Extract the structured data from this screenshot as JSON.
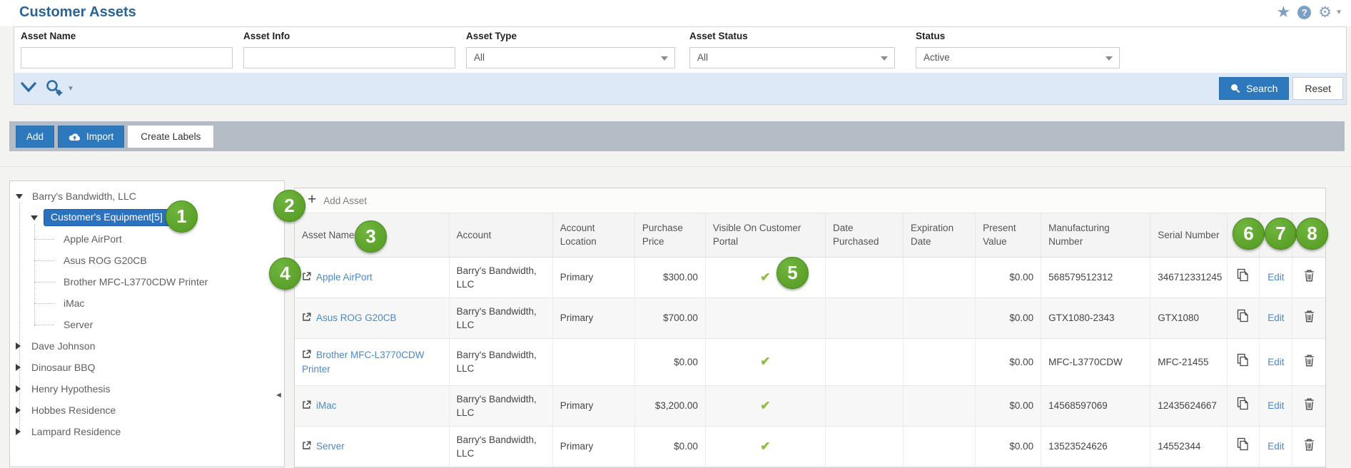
{
  "page": {
    "title": "Customer Assets"
  },
  "header_icons": {
    "help_text": "?"
  },
  "filters": {
    "fields": [
      {
        "label": "Asset Name",
        "type": "text",
        "value": ""
      },
      {
        "label": "Asset Info",
        "type": "text",
        "value": ""
      },
      {
        "label": "Asset Type",
        "type": "select",
        "value": "All"
      },
      {
        "label": "Asset Status",
        "type": "select",
        "value": "All"
      },
      {
        "label": "Status",
        "type": "select",
        "value": "Active"
      }
    ],
    "search_label": "Search",
    "reset_label": "Reset"
  },
  "action_bar": {
    "add_label": "Add",
    "import_label": "Import",
    "create_labels_label": "Create Labels"
  },
  "tree": {
    "root": {
      "label": "Barry's Bandwidth, LLC"
    },
    "selected_group": {
      "label": "Customer's Equipment[5]"
    },
    "assets": [
      "Apple AirPort",
      "Asus ROG G20CB",
      "Brother MFC-L3770CDW Printer",
      "iMac",
      "Server"
    ],
    "accounts": [
      "Dave Johnson",
      "Dinosaur BBQ",
      "Henry Hypothesis",
      "Hobbes Residence",
      "Lampard Residence"
    ]
  },
  "table": {
    "add_asset_label": "Add Asset",
    "edit_label": "Edit",
    "columns": [
      "Asset Name",
      "Account",
      "Account Location",
      "Purchase Price",
      "Visible On Customer Portal",
      "Date Purchased",
      "Expiration Date",
      "Present Value",
      "Manufacturing Number",
      "Serial Number"
    ],
    "rows": [
      {
        "asset_name": "Apple AirPort",
        "account": "Barry's Bandwidth, LLC",
        "account_location": "Primary",
        "purchase_price": "$300.00",
        "visible_check": "✔",
        "date_purchased": "",
        "expiration_date": "",
        "present_value": "$0.00",
        "manufacturing_number": "568579512312",
        "serial_number": "346712331245"
      },
      {
        "asset_name": "Asus ROG G20CB",
        "account": "Barry's Bandwidth, LLC",
        "account_location": "Primary",
        "purchase_price": "$700.00",
        "visible_check": "",
        "date_purchased": "",
        "expiration_date": "",
        "present_value": "$0.00",
        "manufacturing_number": "GTX1080-2343",
        "serial_number": "GTX1080"
      },
      {
        "asset_name": "Brother MFC-L3770CDW Printer",
        "account": "Barry's Bandwidth, LLC",
        "account_location": "",
        "purchase_price": "$0.00",
        "visible_check": "✔",
        "date_purchased": "",
        "expiration_date": "",
        "present_value": "$0.00",
        "manufacturing_number": "MFC-L3770CDW",
        "serial_number": "MFC-21455"
      },
      {
        "asset_name": "iMac",
        "account": "Barry's Bandwidth, LLC",
        "account_location": "Primary",
        "purchase_price": "$3,200.00",
        "visible_check": "✔",
        "date_purchased": "",
        "expiration_date": "",
        "present_value": "$0.00",
        "manufacturing_number": "14568597069",
        "serial_number": "12435624667"
      },
      {
        "asset_name": "Server",
        "account": "Barry's Bandwidth, LLC",
        "account_location": "Primary",
        "purchase_price": "$0.00",
        "visible_check": "✔",
        "date_purchased": "",
        "expiration_date": "",
        "present_value": "$0.00",
        "manufacturing_number": "13523524626",
        "serial_number": "14552344"
      }
    ]
  },
  "badges": [
    "1",
    "2",
    "3",
    "4",
    "5",
    "6",
    "7",
    "8"
  ],
  "colors": {
    "accent_blue": "#2e79bd",
    "link_blue": "#4a89c8",
    "title_blue": "#2a6496",
    "selected_node_blue": "#2a72c0",
    "badge_green": "#5aa02c",
    "check_green": "#8cbf3f",
    "toolbar_gray": "#b4bcc5",
    "search_bar_blue": "#dde9f6"
  }
}
